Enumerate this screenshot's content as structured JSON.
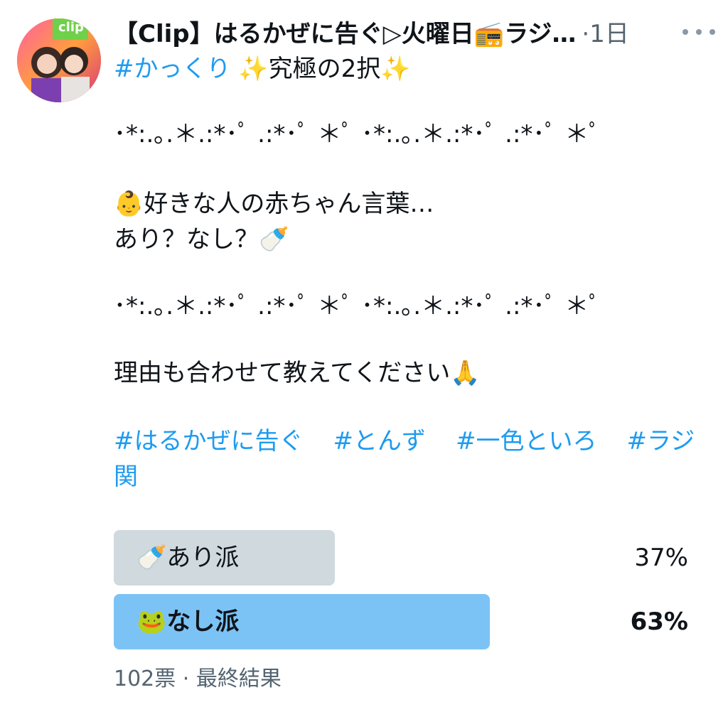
{
  "avatar": {
    "badge": "clip"
  },
  "tweet": {
    "author": "【Clip】はるかぜに告ぐ▷火曜日📻ラジ…",
    "time": "·1日",
    "line1_hashtag": "#かっくり",
    "line1_rest": " ✨究極の2択✨",
    "divider1": "･*:.｡.＊.:*･ﾟ .:*･ﾟ ＊ﾟ ･*:.｡.＊.:*･ﾟ .:*･ﾟ ＊ﾟ",
    "line2": "👶好きな人の赤ちゃん言葉…",
    "line3": "あり？なし？🍼",
    "divider2": "･*:.｡.＊.:*･ﾟ .:*･ﾟ ＊ﾟ ･*:.｡.＊.:*･ﾟ .:*･ﾟ ＊ﾟ",
    "line4": "理由も合わせて教えてください🙏",
    "tags_line1": [
      "#はるかぜに告ぐ",
      "#とんず",
      "#一色といろ",
      "#ラジ"
    ],
    "tags_line2": "関"
  },
  "poll": {
    "options": [
      {
        "label": "🍼あり派",
        "percent_text": "37%",
        "percent": 37,
        "winner": false,
        "color": "#cfd9de"
      },
      {
        "label": "🐸なし派",
        "percent_text": "63%",
        "percent": 63,
        "winner": true,
        "color": "#7cc3f5"
      }
    ],
    "footer": "102票 · 最終結果"
  },
  "colors": {
    "link": "#1d9bf0",
    "muted": "#536471",
    "text": "#0f1419"
  }
}
